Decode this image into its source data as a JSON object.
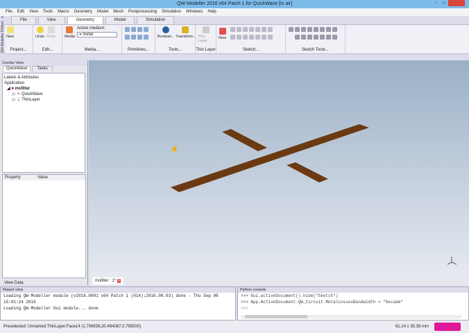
{
  "title": "QW-Modeller 2016 x64 Patch 1 for QuickWave [in air]",
  "menu": [
    "File",
    "Edit",
    "View",
    "Tools",
    "Macro",
    "Geometry",
    "Model",
    "Mesh",
    "Postprocessing",
    "Simulation",
    "Windows",
    "Help"
  ],
  "ribbon_tabs": [
    "File",
    "View",
    "Geometry",
    "Model",
    "Simulation"
  ],
  "ribbon_side_label": "QW-Modeller Ribbon",
  "ribbon": {
    "new": "New",
    "undo": "Undo",
    "redo": "Redo",
    "media": "Media",
    "active_medium_label": "Active medium:",
    "active_medium": "metal",
    "boolean": "Boolean..",
    "transform": "Transform..",
    "thin_layer": "Thin Layer",
    "new2": "New",
    "groups": [
      "Project...",
      "Edit...",
      "Media...",
      "Primitives...",
      "Tools...",
      "Thin Layer",
      "Sketch...",
      "Sketch Tools..."
    ]
  },
  "combo": {
    "title": "Combo View",
    "tabs": [
      "QuickWave",
      "Tasks"
    ],
    "labels_header": "Labels & Attributes",
    "application": "Application",
    "doc": "msfilter",
    "children": [
      "QuickWave",
      "ThinLayer"
    ],
    "prop_cols": [
      "Property",
      "Value"
    ],
    "bottom_tabs": [
      "View",
      "Data"
    ]
  },
  "doc_tab": "msfilter : 1*",
  "report": {
    "title": "Report view",
    "lines": [
      "Loading QW-Modeller module (v2016.0001 x64 Patch 1 (014);2016.08.03) done - Thu Sep 08",
      "15:01:24 2016",
      "Loading QW-Modeller Gui module... done"
    ]
  },
  "python": {
    "title": "Python console",
    "lines": [
      ">>> Gui.activeDocument().hide(\"Sketch\")",
      ">>> App.ActiveDocument.QW_Circuit.MetalLossesBandwidth = \"Decade\"",
      ">>> "
    ]
  },
  "status": {
    "preselected": "Preselected: Unnamed.ThinLayer.Face14 (1.706939,20.494087,0.795500)",
    "dims": "61.14 x 35.39 mm"
  },
  "colors": {
    "shape": "#6b3a12",
    "accent": "#7dbbe8"
  }
}
